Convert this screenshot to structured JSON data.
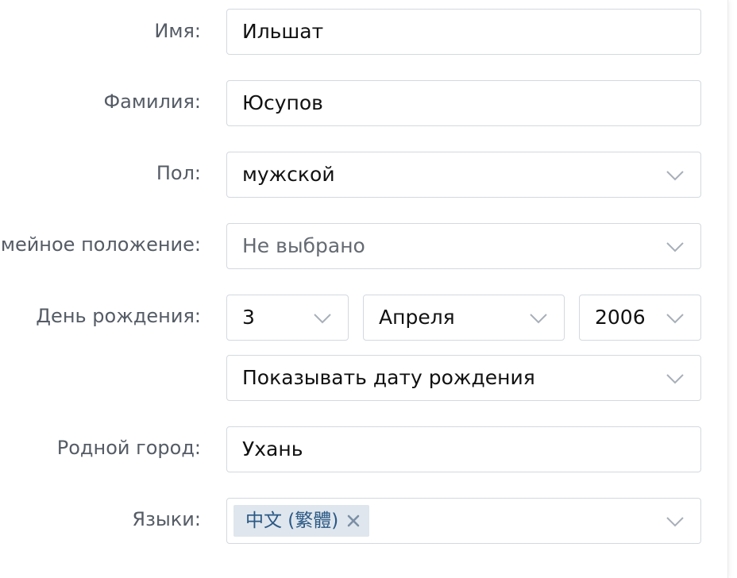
{
  "form": {
    "first_name": {
      "label": "Имя:",
      "value": "Ильшат"
    },
    "last_name": {
      "label": "Фамилия:",
      "value": "Юсупов"
    },
    "gender": {
      "label": "Пол:",
      "value": "мужской"
    },
    "marital_status": {
      "label": "Семейное положение:",
      "value": "Не выбрано"
    },
    "birthday": {
      "label": "День рождения:",
      "day": "3",
      "month": "Апреля",
      "year": "2006",
      "visibility": "Показывать дату рождения"
    },
    "hometown": {
      "label": "Родной город:",
      "value": "Ухань"
    },
    "languages": {
      "label": "Языки:",
      "tags": [
        "中文 (繁體)"
      ]
    }
  },
  "icons": {
    "dropdown": "chevron-down-icon",
    "remove_tag": "close-icon"
  },
  "colors": {
    "label_text": "#555c66",
    "input_border": "#d3d9de",
    "placeholder_text": "#656b73",
    "tag_background": "#dfe6ed",
    "tag_text": "#2a5885",
    "chevron": "#a7afb9"
  }
}
